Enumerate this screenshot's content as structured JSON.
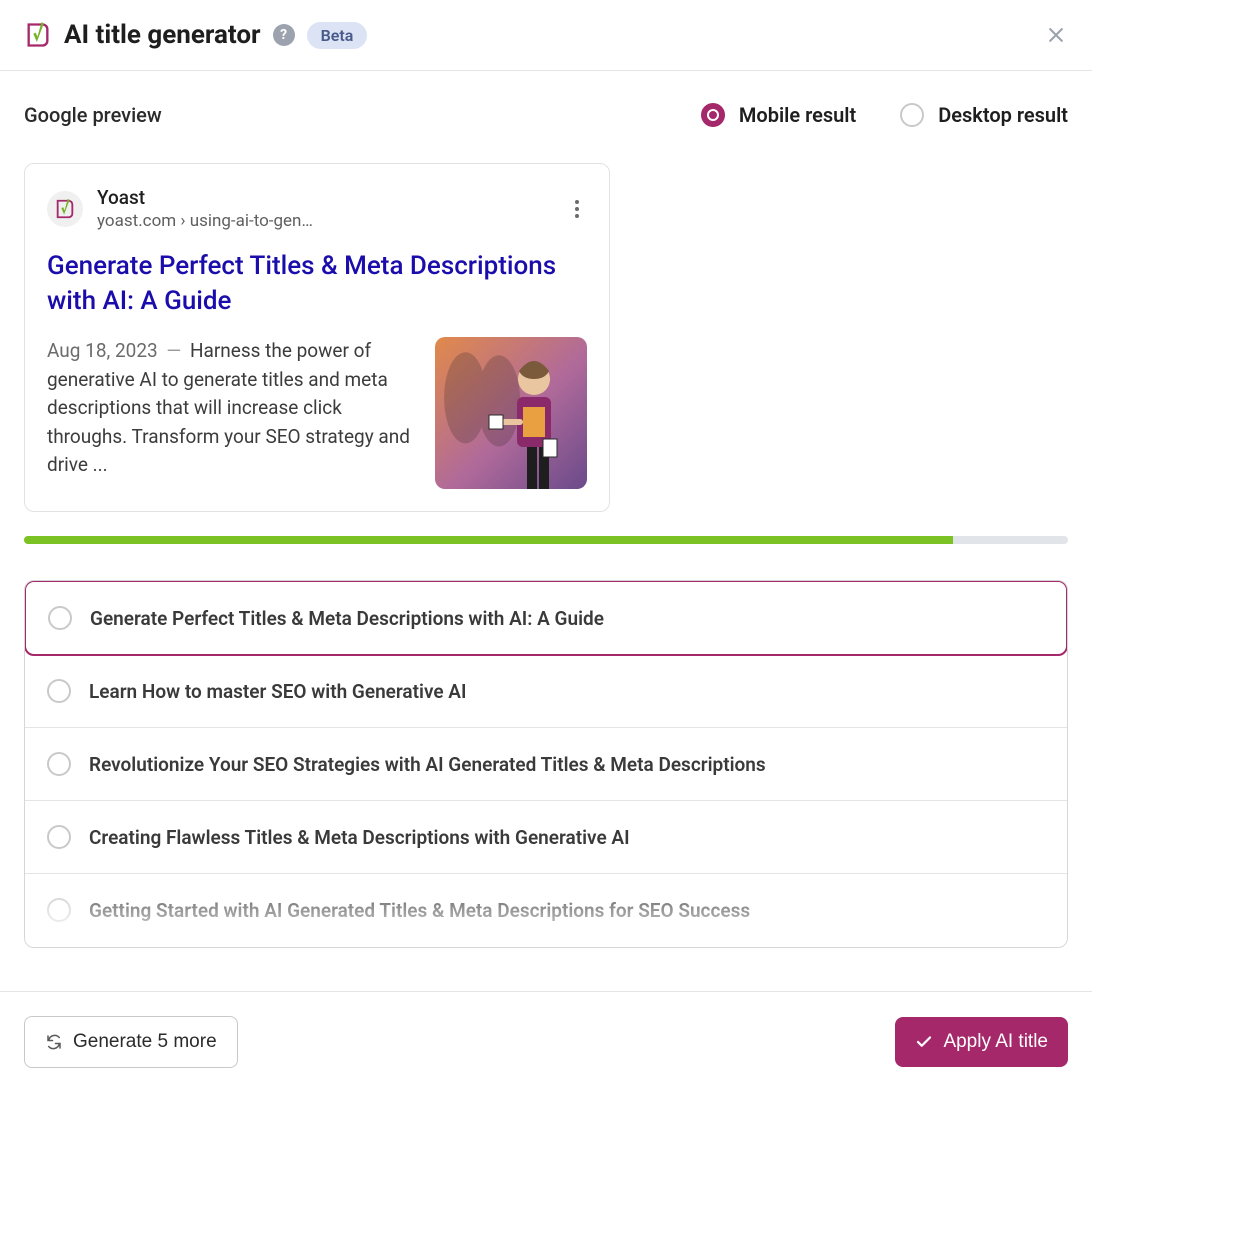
{
  "header": {
    "title": "AI title generator",
    "help_tooltip": "?",
    "badge": "Beta"
  },
  "preview": {
    "section_label": "Google preview",
    "view_modes": {
      "mobile": "Mobile result",
      "desktop": "Desktop result",
      "selected": "mobile"
    },
    "serp": {
      "site_name": "Yoast",
      "site_url": "yoast.com › using-ai-to-gen…",
      "title": "Generate Perfect Titles & Meta Descriptions with AI: A Guide",
      "date": "Aug 18, 2023",
      "dash": "—",
      "description": "Harness the power of generative AI to generate titles and meta descriptions that will increase click throughs. Transform your SEO strategy and drive ..."
    }
  },
  "progress_percent": 89,
  "title_options": [
    {
      "text": "Generate Perfect Titles & Meta Descriptions with AI: A Guide",
      "selected": true
    },
    {
      "text": "Learn How to master SEO with Generative AI",
      "selected": false
    },
    {
      "text": "Revolutionize Your SEO Strategies with AI Generated Titles & Meta Descriptions",
      "selected": false
    },
    {
      "text": "Creating Flawless Titles & Meta Descriptions with Generative AI",
      "selected": false
    },
    {
      "text": "Getting Started with AI Generated Titles & Meta Descriptions for SEO Success",
      "selected": false
    }
  ],
  "footer": {
    "generate_more": "Generate 5 more",
    "apply": "Apply AI title"
  },
  "colors": {
    "brand": "#a4286a",
    "progress": "#7bc225",
    "serp_link": "#1a0dab"
  }
}
